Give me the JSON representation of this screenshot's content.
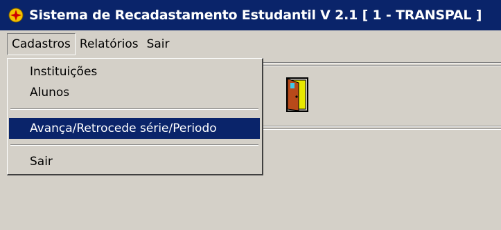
{
  "window": {
    "title": "Sistema de Recadastamento Estudantil V 2.1 [ 1 - TRANSPAL ]",
    "icon": "app-icon"
  },
  "menubar": {
    "items": [
      {
        "label": "Cadastros"
      },
      {
        "label": "Relatórios"
      },
      {
        "label": "Sair"
      }
    ]
  },
  "dropdown": {
    "items": [
      {
        "label": "Instituições"
      },
      {
        "label": "Alunos"
      },
      {
        "label": "Avança/Retrocede série/Periodo"
      },
      {
        "label": "Sair"
      }
    ],
    "selected_label": "Avança/Retrocede série/Periodo"
  },
  "toolbar": {
    "exit_icon": "door-exit-icon"
  },
  "colors": {
    "titlebar": "#0a246a",
    "face": "#d4d0c8",
    "selection": "#0a246a"
  }
}
